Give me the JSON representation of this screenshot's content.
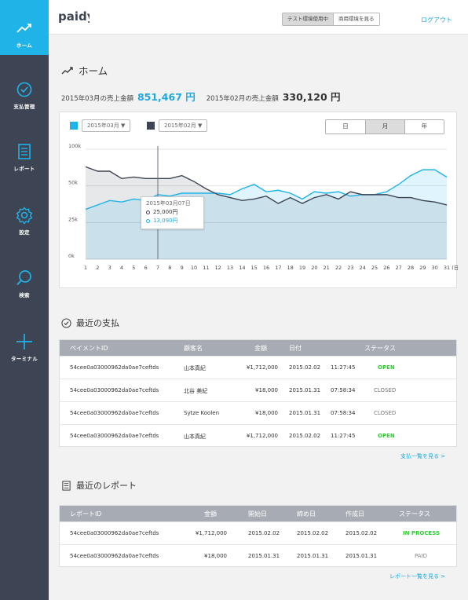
{
  "header": {
    "logo_text": "paidy",
    "env_test": "テスト環境使用中",
    "env_prod": "商用環境を見る",
    "logout": "ログアウト"
  },
  "sidebar": {
    "items": [
      {
        "label": "ホーム",
        "icon": "trend-icon"
      },
      {
        "label": "支払管理",
        "icon": "check-circle-icon"
      },
      {
        "label": "レポート",
        "icon": "report-icon"
      },
      {
        "label": "設定",
        "icon": "gear-icon"
      },
      {
        "label": "検索",
        "icon": "search-icon"
      },
      {
        "label": "ターミナル",
        "icon": "plus-icon"
      }
    ]
  },
  "page": {
    "title": "ホーム",
    "sales_current_label": "2015年03月の売上金額",
    "sales_current_value": "851,467 円",
    "sales_previous_label": "2015年02月の売上金額",
    "sales_previous_value": "330,120 円"
  },
  "chart_controls": {
    "series_a_select": "2015年03月 ▼",
    "series_b_select": "2015年02月 ▼",
    "period_day": "日",
    "period_month": "月",
    "period_year": "年",
    "active_period": "月"
  },
  "tooltip": {
    "date": "2015年03月07日",
    "value_dark": "25,000円",
    "value_blue": "13,090円"
  },
  "chart_data": {
    "type": "area",
    "x": [
      1,
      2,
      3,
      4,
      5,
      6,
      7,
      8,
      9,
      10,
      11,
      12,
      13,
      14,
      15,
      16,
      17,
      18,
      19,
      20,
      21,
      22,
      23,
      24,
      25,
      26,
      27,
      28,
      29,
      30,
      31
    ],
    "x_tick_labels": [
      "1",
      "2",
      "3",
      "4",
      "5",
      "6",
      "7",
      "8",
      "9",
      "10",
      "11",
      "12",
      "13",
      "14",
      "15",
      "16",
      "17",
      "18",
      "19",
      "20",
      "21",
      "22",
      "23",
      "24",
      "25",
      "26",
      "27",
      "28",
      "29",
      "30",
      "31",
      "(日)"
    ],
    "y_tick_labels": [
      "100k",
      "50k",
      "25k",
      "0k"
    ],
    "y_ticks": [
      0,
      25,
      50,
      100
    ],
    "y_display_range": [
      0,
      75
    ],
    "grid": true,
    "series": [
      {
        "name": "2015年03月",
        "color": "#1fb3e8",
        "values": [
          34,
          37,
          40,
          39,
          41,
          40,
          44,
          43,
          45,
          45,
          45,
          45,
          44,
          48,
          51,
          46,
          47,
          45,
          41,
          46,
          45,
          46,
          43,
          44,
          44,
          46,
          51,
          57,
          61,
          61,
          56
        ]
      },
      {
        "name": "2015年02月",
        "color": "#3d4554",
        "values": [
          63,
          60,
          60,
          55,
          56,
          55,
          55,
          55,
          57,
          53,
          48,
          44,
          42,
          40,
          41,
          43,
          38,
          42,
          38,
          42,
          44,
          41,
          46,
          44,
          44,
          44,
          42,
          42,
          40,
          39,
          37
        ]
      }
    ],
    "highlight_x": 7
  },
  "payments": {
    "title": "最近の支払",
    "columns": [
      "ペイメントID",
      "顧客名",
      "金額",
      "日付",
      "ステータス"
    ],
    "rows": [
      {
        "id": "54cee0a03000962da0ae7ceftds",
        "customer": "山本真紀",
        "amount": "¥1,712,000",
        "date": "2015.02.02",
        "time": "11:27:45",
        "status": "OPEN"
      },
      {
        "id": "54cee0a03000962da0ae7ceftds",
        "customer": "北谷 美紀",
        "amount": "¥18,000",
        "date": "2015.01.31",
        "time": "07:58:34",
        "status": "CLOSED"
      },
      {
        "id": "54cee0a03000962da0ae7ceftds",
        "customer": "Sytze Koolen",
        "amount": "¥18,000",
        "date": "2015.01.31",
        "time": "07:58:34",
        "status": "CLOSED"
      },
      {
        "id": "54cee0a03000962da0ae7ceftds",
        "customer": "山本真紀",
        "amount": "¥1,712,000",
        "date": "2015.02.02",
        "time": "11:27:45",
        "status": "OPEN"
      }
    ],
    "more": "支払一覧を見る >"
  },
  "reports": {
    "title": "最近のレポート",
    "columns": [
      "レポートID",
      "金額",
      "開始日",
      "締め日",
      "作成日",
      "ステータス"
    ],
    "rows": [
      {
        "id": "54cee0a03000962da0ae7ceftds",
        "amount": "¥1,712,000",
        "start": "2015.02.02",
        "close": "2015.02.02",
        "created": "2015.02.02",
        "status": "IN PROCESS"
      },
      {
        "id": "54cee0a03000962da0ae7ceftds",
        "amount": "¥18,000",
        "start": "2015.01.31",
        "close": "2015.01.31",
        "created": "2015.01.31",
        "status": "PAID"
      }
    ],
    "more": "レポート一覧を見る >"
  },
  "colors": {
    "accent": "#1fb3e8",
    "sidebar": "#3d4554",
    "status_green": "#2ecc30"
  }
}
